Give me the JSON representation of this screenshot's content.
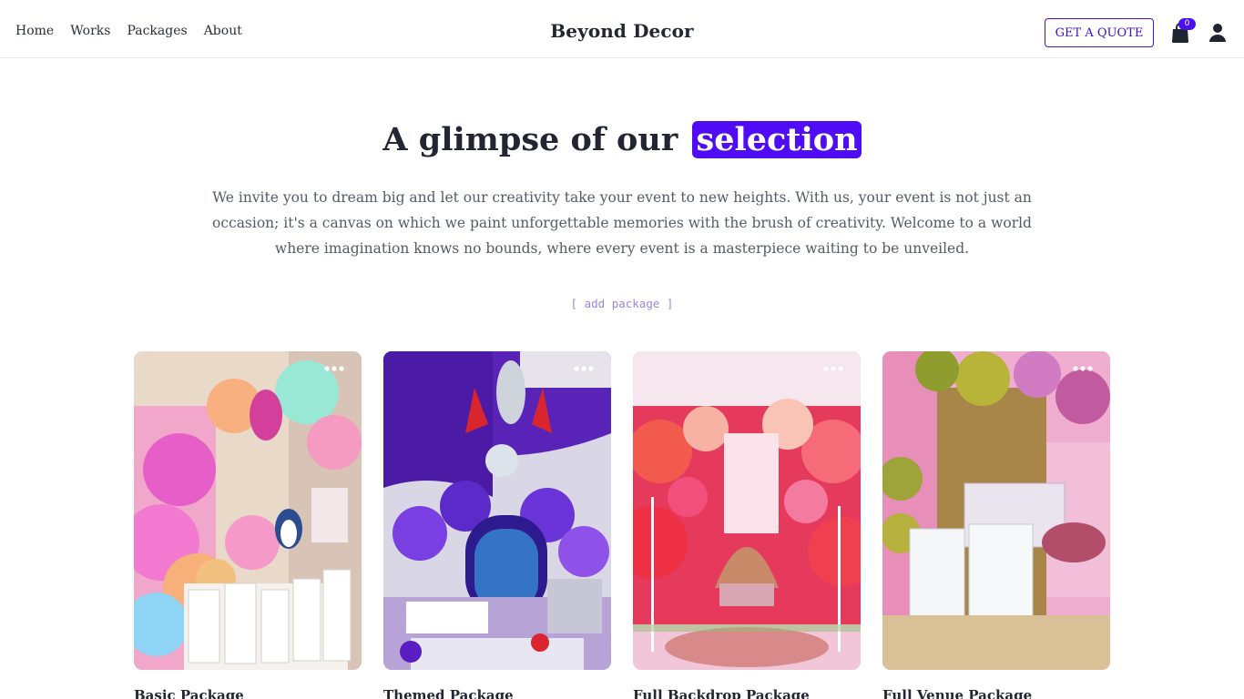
{
  "nav": {
    "home": "Home",
    "works": "Works",
    "packages": "Packages",
    "about": "About"
  },
  "brand": "Beyond Decor",
  "header": {
    "quote_label": "GET A QUOTE",
    "cart_count": "0",
    "cart_icon": "shopping-bag-icon",
    "user_icon": "user-icon"
  },
  "hero": {
    "title_prefix": "A glimpse of our",
    "title_highlight": "selection",
    "description": "We invite you to dream big and let our creativity take your event to new heights. With us, your event is not just an occasion; it's a canvas on which we paint unforgettable memories with the brush of creativity. Welcome to a world where imagination knows no bounds, where every event is a masterpiece waiting to be unveiled.",
    "add_package": "[ add package ]"
  },
  "colors": {
    "accent": "#4f0cf5",
    "text": "#222633",
    "muted": "#555a66"
  },
  "packages": [
    {
      "title": "Basic Package",
      "menu_icon": "more-dots-icon"
    },
    {
      "title": "Themed Package",
      "menu_icon": "more-dots-icon"
    },
    {
      "title": "Full Backdrop Package",
      "menu_icon": "more-dots-icon"
    },
    {
      "title": "Full Venue Package",
      "menu_icon": "more-dots-icon"
    }
  ]
}
